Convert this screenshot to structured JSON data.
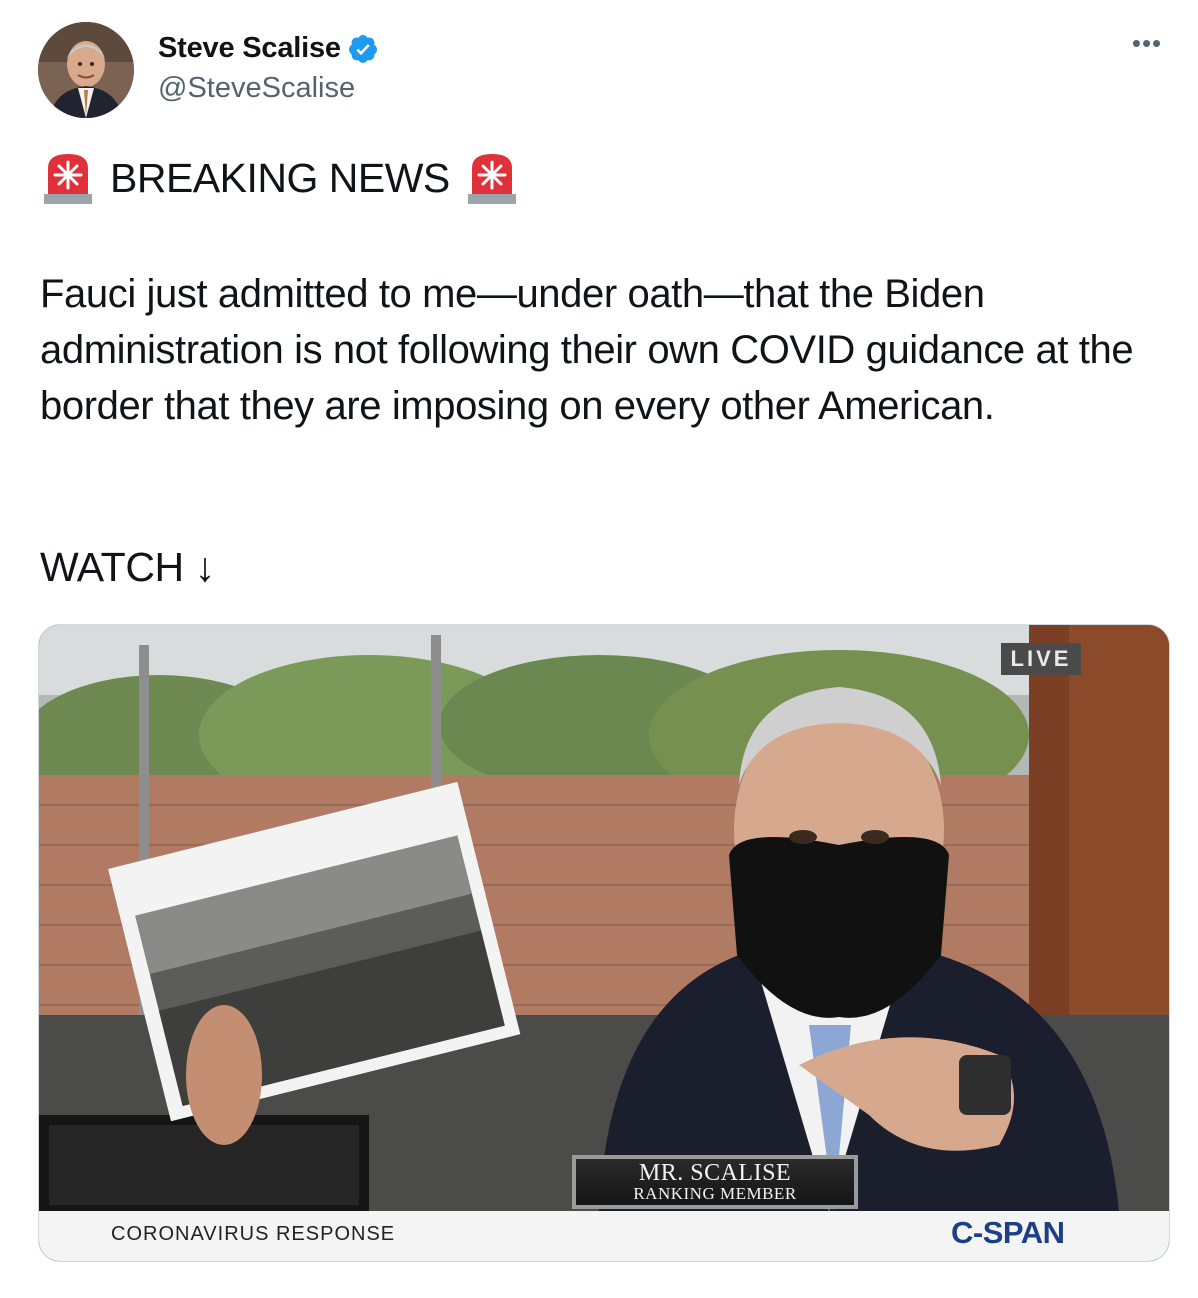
{
  "tweet": {
    "author": {
      "name": "Steve Scalise",
      "handle": "@SteveScalise",
      "verified": true
    },
    "more_icon": "more-horizontal-icon",
    "headline_text": "BREAKING NEWS",
    "headline_icon": "rotating-light-emoji",
    "body": "Fauci just admitted to me—under oath—that the Biden administration is not following their own COVID guidance at the border that they are imposing on every other American.",
    "watch_text": "WATCH ↓"
  },
  "video": {
    "live_badge": "LIVE",
    "nameplate_line1": "MR. SCALISE",
    "nameplate_line2": "RANKING MEMBER",
    "bottom_left_label": "CORONAVIRUS RESPONSE",
    "network_logo": "C-SPAN",
    "accent": "#1d3f86"
  },
  "colors": {
    "text": "#0f1419",
    "secondary": "#536471",
    "verified": "#1d9bf0",
    "border": "#cfd9de"
  }
}
